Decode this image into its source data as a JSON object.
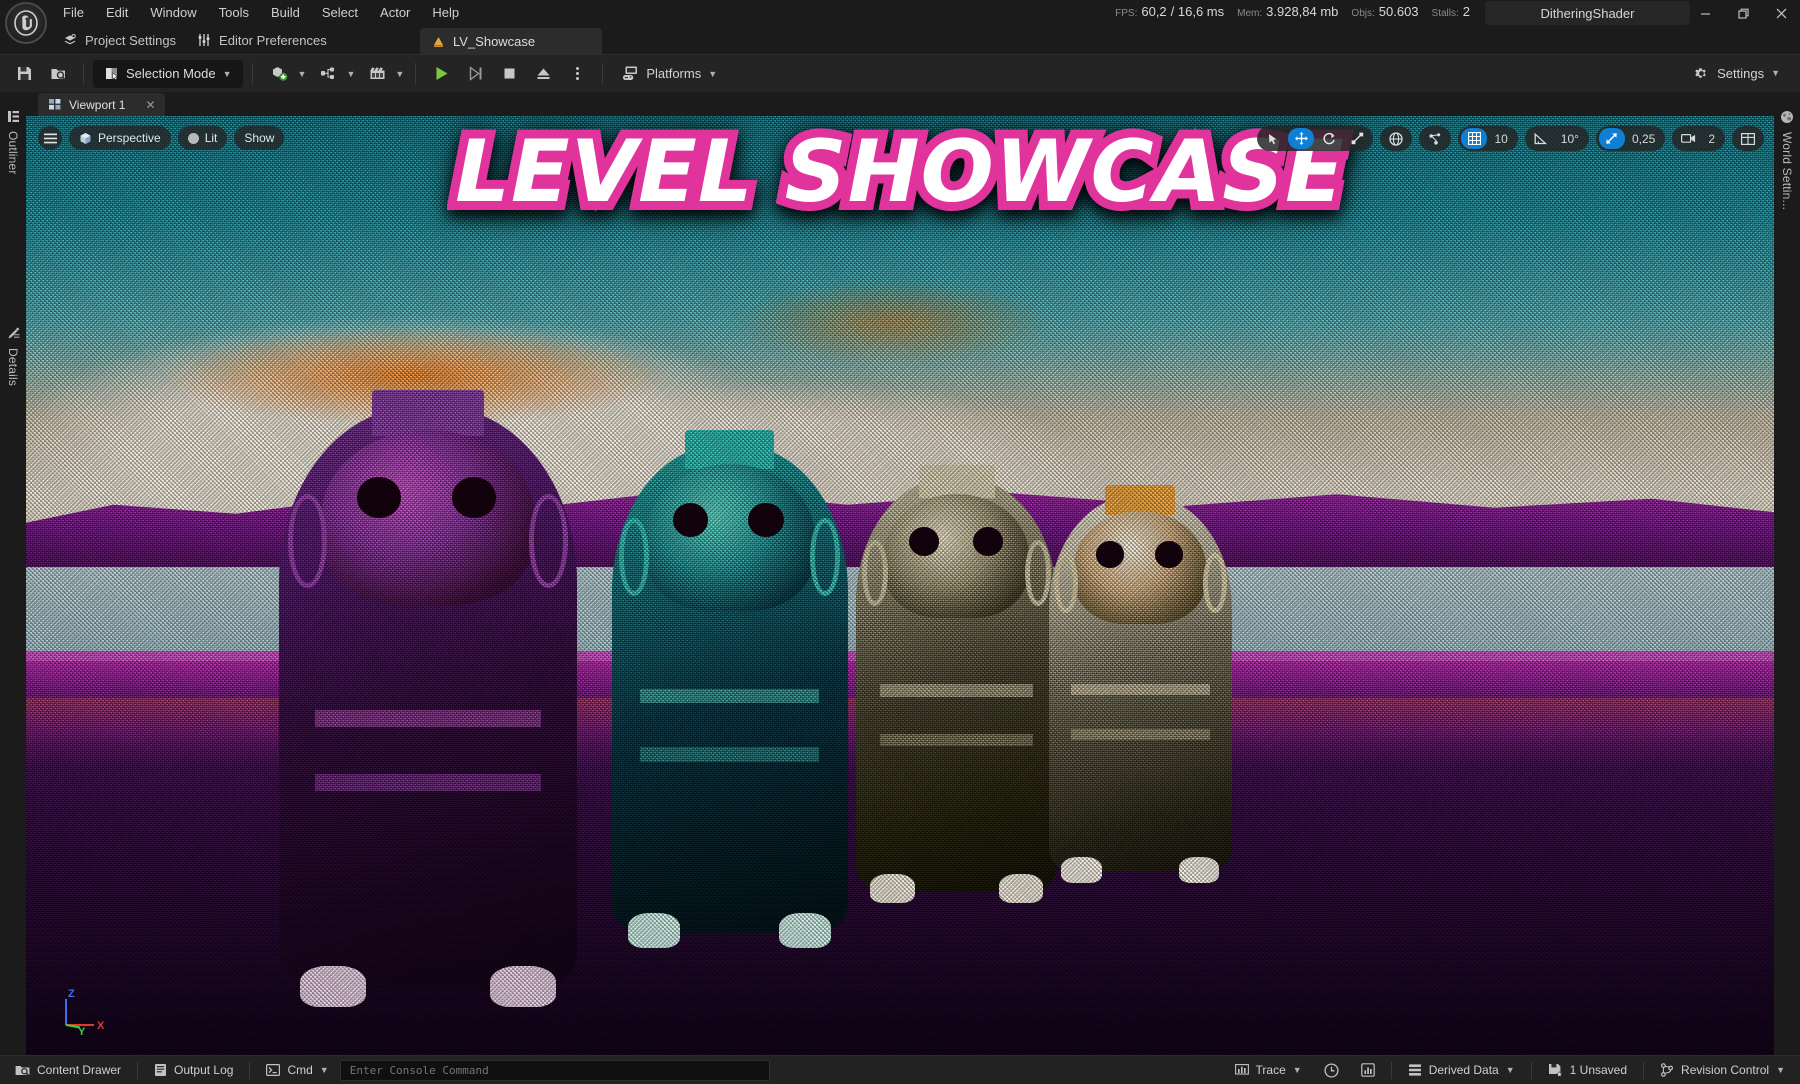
{
  "window": {
    "title": "DitheringShader",
    "minimize_label": "–",
    "restore_label": "❐",
    "close_label": "✕"
  },
  "menu": {
    "items": [
      {
        "label": "File"
      },
      {
        "label": "Edit"
      },
      {
        "label": "Window"
      },
      {
        "label": "Tools"
      },
      {
        "label": "Build"
      },
      {
        "label": "Select"
      },
      {
        "label": "Actor"
      },
      {
        "label": "Help"
      }
    ]
  },
  "stats": [
    {
      "key": "FPS:",
      "value": "60,2"
    },
    {
      "key": "",
      "value": "/ 16,6 ms"
    },
    {
      "key": "Mem:",
      "value": "3.928,84 mb"
    },
    {
      "key": "Objs:",
      "value": "50.603"
    },
    {
      "key": "Stalls:",
      "value": "2"
    }
  ],
  "shortcuts": [
    {
      "label": "Project Settings",
      "icon": "project-settings-icon"
    },
    {
      "label": "Editor Preferences",
      "icon": "editor-preferences-icon"
    }
  ],
  "level_tab": {
    "label": "LV_Showcase",
    "icon": "level-icon"
  },
  "toolbar": {
    "save_label": "Save",
    "browse_label": "Browse",
    "mode_label": "Selection Mode",
    "create_label": "Create",
    "blueprints_label": "Blueprints",
    "cinematics_label": "Cinematics",
    "play_label": "Play",
    "skip_label": "Skip",
    "stop_label": "Stop",
    "eject_label": "Eject",
    "more_label": "More Play Options",
    "platforms_label": "Platforms",
    "settings_label": "Settings"
  },
  "left_sidebar": {
    "items": [
      {
        "label": "Outliner",
        "icon": "outliner-icon"
      },
      {
        "label": "Details",
        "icon": "details-icon"
      }
    ]
  },
  "right_sidebar": {
    "items": [
      {
        "label": "World Settin...",
        "icon": "world-settings-icon"
      }
    ]
  },
  "viewport": {
    "tab_label": "Viewport 1",
    "close_label": "✕",
    "overlay_text": "LEVEL SHOWCASE",
    "left_controls": [
      {
        "label": "Perspective",
        "icon": "cube-icon"
      },
      {
        "label": "Lit",
        "icon": "lighting-icon"
      },
      {
        "label": "Show",
        "icon": "show-icon"
      }
    ],
    "menu_label": "Viewport Options",
    "transform_tools": [
      {
        "name": "select-tool",
        "glyph": "➤",
        "active": false
      },
      {
        "name": "move-tool",
        "glyph": "✥",
        "active": true
      },
      {
        "name": "rotate-tool",
        "glyph": "⟳",
        "active": false
      },
      {
        "name": "scale-tool",
        "glyph": "⤢",
        "active": false
      }
    ],
    "coordinate_system": {
      "name": "world-coordinate-toggle",
      "glyph": "⊕"
    },
    "surface_snap": {
      "name": "surface-snap-toggle",
      "glyph": "⁂"
    },
    "grid_snap": {
      "label": "10",
      "active": true,
      "icon": "grid-icon"
    },
    "angle_snap": {
      "label": "10°",
      "active": false,
      "icon": "angle-icon"
    },
    "scale_snap": {
      "label": "0,25",
      "active": true,
      "icon": "scale-snap-icon"
    },
    "camera_speed": {
      "label": "2",
      "icon": "camera-icon"
    },
    "layouts": {
      "name": "viewport-layouts",
      "icon": "layout-icon"
    },
    "axis_labels": {
      "x": "X",
      "y": "Y",
      "z": "Z"
    },
    "axis_colors": {
      "x": "#e03a2f",
      "y": "#3ecf3e",
      "z": "#3a6ff0"
    }
  },
  "statusbar": {
    "content_drawer": "Content Drawer",
    "output_log": "Output Log",
    "cmd": "Cmd",
    "console_placeholder": "Enter Console Command",
    "trace": "Trace",
    "derived_data": "Derived Data",
    "unsaved": "1 Unsaved",
    "revision_control": "Revision Control"
  },
  "colors": {
    "accent_blue": "#0f7fd4",
    "play_green": "#7bc943",
    "level_orange": "#e8a33d",
    "overlay_pink": "#e0349c",
    "panel_bg": "#242424",
    "window_bg": "#1b1b1b"
  },
  "scene": {
    "description": "Dithered retro-shaded level with four stone idol statues on a magenta terrain under a teal sky",
    "palette": [
      "#1d7e8c",
      "#2a93a0",
      "#e8e0d2",
      "#f07e18",
      "#e039c6",
      "#7b1f8e",
      "#120419"
    ]
  }
}
